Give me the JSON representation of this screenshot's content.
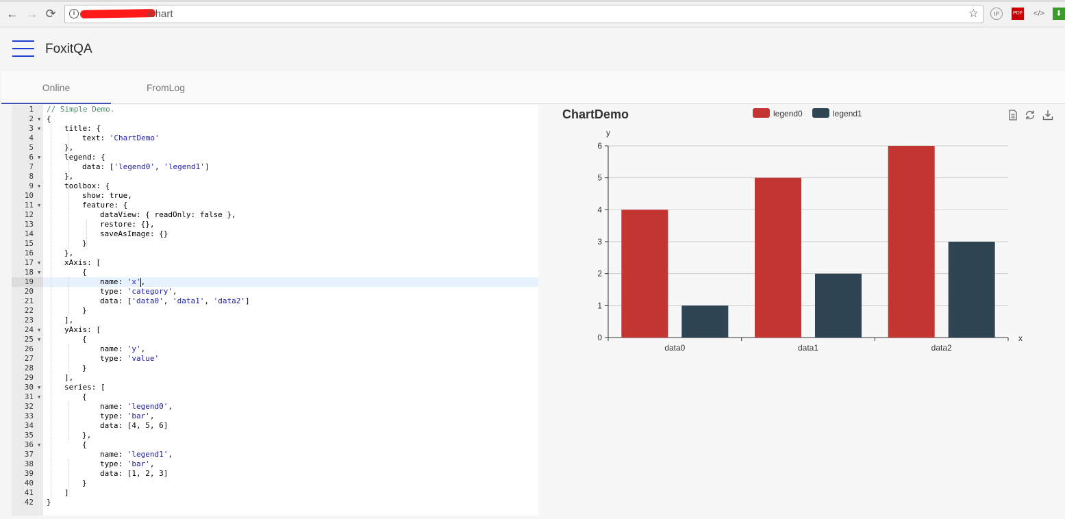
{
  "browser": {
    "url_visible": "/chart",
    "nav": {
      "back": "←",
      "forward": "→",
      "reload": "⟳"
    },
    "star_icon": "☆",
    "extensions": [
      "IP",
      "PDF",
      "</>",
      "⬇"
    ]
  },
  "app": {
    "title": "FoxitQA"
  },
  "tabs": [
    {
      "label": "Online",
      "active": true
    },
    {
      "label": "FromLog",
      "active": false
    }
  ],
  "editor": {
    "highlighted_line": 19,
    "lines": [
      {
        "n": "1",
        "indent": 0,
        "fold": false,
        "parts": [
          [
            "// Simple Demo.",
            "cmt"
          ]
        ]
      },
      {
        "n": "2",
        "indent": 0,
        "fold": true,
        "parts": [
          [
            "{",
            ""
          ]
        ]
      },
      {
        "n": "3",
        "indent": 1,
        "fold": true,
        "parts": [
          [
            "title: {",
            ""
          ]
        ]
      },
      {
        "n": "4",
        "indent": 2,
        "fold": false,
        "parts": [
          [
            "text: ",
            ""
          ],
          [
            "'ChartDemo'",
            "str"
          ]
        ]
      },
      {
        "n": "5",
        "indent": 1,
        "fold": false,
        "parts": [
          [
            "},",
            ""
          ]
        ]
      },
      {
        "n": "6",
        "indent": 1,
        "fold": true,
        "parts": [
          [
            "legend: {",
            ""
          ]
        ]
      },
      {
        "n": "7",
        "indent": 2,
        "fold": false,
        "parts": [
          [
            "data: [",
            ""
          ],
          [
            "'legend0'",
            "str"
          ],
          [
            ", ",
            ""
          ],
          [
            "'legend1'",
            "str"
          ],
          [
            "]",
            ""
          ]
        ]
      },
      {
        "n": "8",
        "indent": 1,
        "fold": false,
        "parts": [
          [
            "},",
            ""
          ]
        ]
      },
      {
        "n": "9",
        "indent": 1,
        "fold": true,
        "parts": [
          [
            "toolbox: {",
            ""
          ]
        ]
      },
      {
        "n": "10",
        "indent": 2,
        "fold": false,
        "parts": [
          [
            "show: true,",
            ""
          ]
        ]
      },
      {
        "n": "11",
        "indent": 2,
        "fold": true,
        "parts": [
          [
            "feature: {",
            ""
          ]
        ]
      },
      {
        "n": "12",
        "indent": 3,
        "fold": false,
        "parts": [
          [
            "dataView: { readOnly: false },",
            ""
          ]
        ]
      },
      {
        "n": "13",
        "indent": 3,
        "fold": false,
        "parts": [
          [
            "restore: {},",
            ""
          ]
        ]
      },
      {
        "n": "14",
        "indent": 3,
        "fold": false,
        "parts": [
          [
            "saveAsImage: {}",
            ""
          ]
        ]
      },
      {
        "n": "15",
        "indent": 2,
        "fold": false,
        "parts": [
          [
            "}",
            ""
          ]
        ]
      },
      {
        "n": "16",
        "indent": 1,
        "fold": false,
        "parts": [
          [
            "},",
            ""
          ]
        ]
      },
      {
        "n": "17",
        "indent": 1,
        "fold": true,
        "parts": [
          [
            "xAxis: [",
            ""
          ]
        ]
      },
      {
        "n": "18",
        "indent": 2,
        "fold": true,
        "parts": [
          [
            "{",
            ""
          ]
        ]
      },
      {
        "n": "19",
        "indent": 3,
        "fold": false,
        "parts": [
          [
            "name: ",
            ""
          ],
          [
            "'x'",
            "str"
          ],
          [
            ",",
            ""
          ]
        ]
      },
      {
        "n": "20",
        "indent": 3,
        "fold": false,
        "parts": [
          [
            "type: ",
            ""
          ],
          [
            "'category'",
            "str"
          ],
          [
            ",",
            ""
          ]
        ]
      },
      {
        "n": "21",
        "indent": 3,
        "fold": false,
        "parts": [
          [
            "data: [",
            ""
          ],
          [
            "'data0'",
            "str"
          ],
          [
            ", ",
            ""
          ],
          [
            "'data1'",
            "str"
          ],
          [
            ", ",
            ""
          ],
          [
            "'data2'",
            "str"
          ],
          [
            "]",
            ""
          ]
        ]
      },
      {
        "n": "22",
        "indent": 2,
        "fold": false,
        "parts": [
          [
            "}",
            ""
          ]
        ]
      },
      {
        "n": "23",
        "indent": 1,
        "fold": false,
        "parts": [
          [
            "],",
            ""
          ]
        ]
      },
      {
        "n": "24",
        "indent": 1,
        "fold": true,
        "parts": [
          [
            "yAxis: [",
            ""
          ]
        ]
      },
      {
        "n": "25",
        "indent": 2,
        "fold": true,
        "parts": [
          [
            "{",
            ""
          ]
        ]
      },
      {
        "n": "26",
        "indent": 3,
        "fold": false,
        "parts": [
          [
            "name: ",
            ""
          ],
          [
            "'y'",
            "str"
          ],
          [
            ",",
            ""
          ]
        ]
      },
      {
        "n": "27",
        "indent": 3,
        "fold": false,
        "parts": [
          [
            "type: ",
            ""
          ],
          [
            "'value'",
            "str"
          ]
        ]
      },
      {
        "n": "28",
        "indent": 2,
        "fold": false,
        "parts": [
          [
            "}",
            ""
          ]
        ]
      },
      {
        "n": "29",
        "indent": 1,
        "fold": false,
        "parts": [
          [
            "],",
            ""
          ]
        ]
      },
      {
        "n": "30",
        "indent": 1,
        "fold": true,
        "parts": [
          [
            "series: [",
            ""
          ]
        ]
      },
      {
        "n": "31",
        "indent": 2,
        "fold": true,
        "parts": [
          [
            "{",
            ""
          ]
        ]
      },
      {
        "n": "32",
        "indent": 3,
        "fold": false,
        "parts": [
          [
            "name: ",
            ""
          ],
          [
            "'legend0'",
            "str"
          ],
          [
            ",",
            ""
          ]
        ]
      },
      {
        "n": "33",
        "indent": 3,
        "fold": false,
        "parts": [
          [
            "type: ",
            ""
          ],
          [
            "'bar'",
            "str"
          ],
          [
            ",",
            ""
          ]
        ]
      },
      {
        "n": "34",
        "indent": 3,
        "fold": false,
        "parts": [
          [
            "data: [4, 5, 6]",
            ""
          ]
        ]
      },
      {
        "n": "35",
        "indent": 2,
        "fold": false,
        "parts": [
          [
            "},",
            ""
          ]
        ]
      },
      {
        "n": "36",
        "indent": 2,
        "fold": true,
        "parts": [
          [
            "{",
            ""
          ]
        ]
      },
      {
        "n": "37",
        "indent": 3,
        "fold": false,
        "parts": [
          [
            "name: ",
            ""
          ],
          [
            "'legend1'",
            "str"
          ],
          [
            ",",
            ""
          ]
        ]
      },
      {
        "n": "38",
        "indent": 3,
        "fold": false,
        "parts": [
          [
            "type: ",
            ""
          ],
          [
            "'bar'",
            "str"
          ],
          [
            ",",
            ""
          ]
        ]
      },
      {
        "n": "39",
        "indent": 3,
        "fold": false,
        "parts": [
          [
            "data: [1, 2, 3]",
            ""
          ]
        ]
      },
      {
        "n": "40",
        "indent": 2,
        "fold": false,
        "parts": [
          [
            "}",
            ""
          ]
        ]
      },
      {
        "n": "41",
        "indent": 1,
        "fold": false,
        "parts": [
          [
            "]",
            ""
          ]
        ]
      },
      {
        "n": "42",
        "indent": 0,
        "fold": false,
        "parts": [
          [
            "}",
            ""
          ]
        ]
      }
    ]
  },
  "toolbox": [
    "data-view-icon",
    "restore-icon",
    "save-as-image-icon"
  ],
  "chart_data": {
    "type": "bar",
    "title": "ChartDemo",
    "xlabel": "x",
    "ylabel": "y",
    "categories": [
      "data0",
      "data1",
      "data2"
    ],
    "series": [
      {
        "name": "legend0",
        "values": [
          4,
          5,
          6
        ],
        "color": "#c23531"
      },
      {
        "name": "legend1",
        "values": [
          1,
          2,
          3
        ],
        "color": "#2f4554"
      }
    ],
    "ylim": [
      0,
      6
    ],
    "yticks": [
      0,
      1,
      2,
      3,
      4,
      5,
      6
    ],
    "grid": true,
    "legend_position": "top-center"
  }
}
